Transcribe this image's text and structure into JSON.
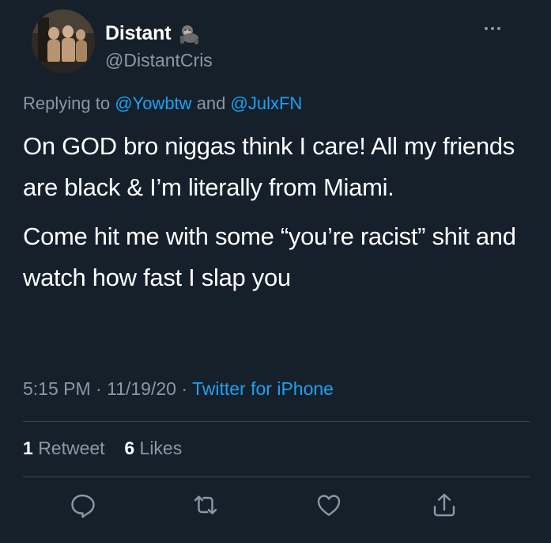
{
  "tweet": {
    "display_name": "Distant",
    "name_emoji": "gorilla-emoji",
    "handle": "@DistantCris",
    "reply_prefix": "Replying to",
    "reply_mention_1": "@Yowbtw",
    "reply_joiner": "and",
    "reply_mention_2": "@JulxFN",
    "paragraph_1": "On GOD bro niggas think I care! All my friends are black & I’m literally from Miami.",
    "paragraph_2": "Come hit me with some “you’re racist” shit and watch how fast I slap you",
    "time": "5:15 PM",
    "separator": "·",
    "date": "11/19/20",
    "source": "Twitter for iPhone",
    "retweet_count": "1",
    "retweet_label": "Retweet",
    "like_count": "6",
    "like_label": "Likes"
  },
  "icons": {
    "more": "more-icon",
    "reply": "reply-icon",
    "retweet": "retweet-icon",
    "like": "like-icon",
    "share": "share-icon"
  },
  "colors": {
    "background": "#15202b",
    "text": "#ffffff",
    "secondary_text": "#8899a6",
    "accent": "#1da1f2",
    "divider": "#38444d"
  }
}
